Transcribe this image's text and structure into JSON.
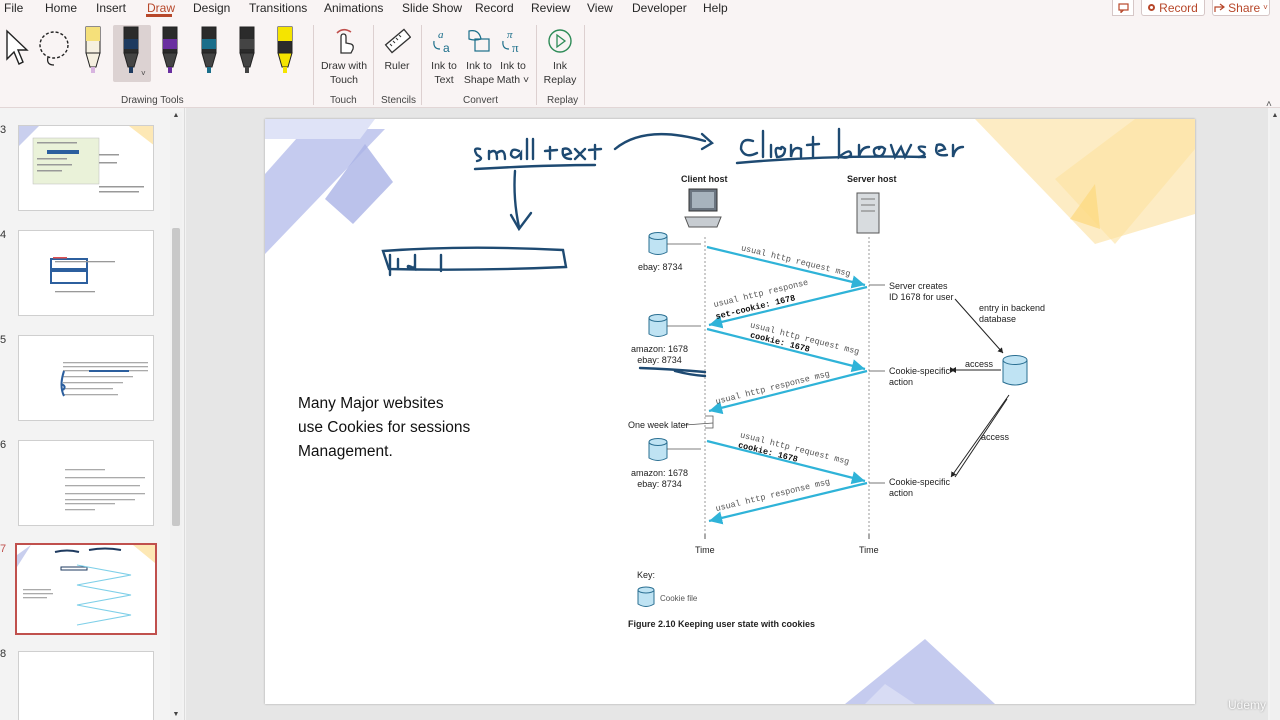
{
  "menu": {
    "tabs": [
      "File",
      "Home",
      "Insert",
      "Draw",
      "Design",
      "Transitions",
      "Animations",
      "Slide Show",
      "Record",
      "Review",
      "View",
      "Developer",
      "Help"
    ],
    "active_tab": "Draw",
    "record_label": "Record",
    "share_label": "Share"
  },
  "ribbon": {
    "groups": {
      "drawing_tools": "Drawing Tools",
      "touch": "Touch",
      "stencils": "Stencils",
      "convert": "Convert",
      "replay": "Replay"
    },
    "buttons": {
      "draw_with_touch": "Draw with\nTouch",
      "ruler": "Ruler",
      "ink_to_text": "Ink to\nText",
      "ink_to_shape": "Ink to\nShape",
      "ink_to_math": "Ink to\nMath ˅",
      "ink_replay": "Ink\nReplay"
    },
    "pen_colors": [
      "#f5e07a",
      "#1e3a5f",
      "#6a2fa0",
      "#1b6e8a",
      "#444444",
      "#f5e400"
    ]
  },
  "thumbnails": [
    {
      "num": "3"
    },
    {
      "num": "4"
    },
    {
      "num": "5"
    },
    {
      "num": "6"
    },
    {
      "num": "7",
      "selected": true
    },
    {
      "num": "8"
    }
  ],
  "slide": {
    "body_text": "Many Major websites\nuse Cookies for sessions\nManagement.",
    "handwriting": {
      "small_text": "small text",
      "client_browser": "Client browser",
      "id": "Id"
    },
    "diagram": {
      "client_host": "Client host",
      "server_host": "Server host",
      "ebay_1": "ebay: 8734",
      "amazon_ebay_2": "amazon: 1678\nebay: 8734",
      "amazon_ebay_3": "amazon: 1678\nebay: 8734",
      "server_creates": "Server creates\nID 1678 for user",
      "entry_backend": "entry in backend\ndatabase",
      "access_1": "access",
      "access_2": "access",
      "cookie_action_1": "Cookie-specific\naction",
      "cookie_action_2": "Cookie-specific\naction",
      "one_week": "One week later",
      "time_left": "Time",
      "time_right": "Time",
      "key": "Key:",
      "cookie_file": "Cookie file",
      "caption": "Figure 2.10 Keeping user state with cookies",
      "msg_1": "usual http request msg",
      "msg_2a": "usual http response",
      "msg_2b": "set-cookie: 1678",
      "msg_3a": "usual http request msg",
      "msg_3b": "cookie: 1678",
      "msg_4": "usual http response msg",
      "msg_5a": "usual http request msg",
      "msg_5b": "cookie: 1678",
      "msg_6": "usual http response msg"
    }
  },
  "watermark": "Udemy"
}
